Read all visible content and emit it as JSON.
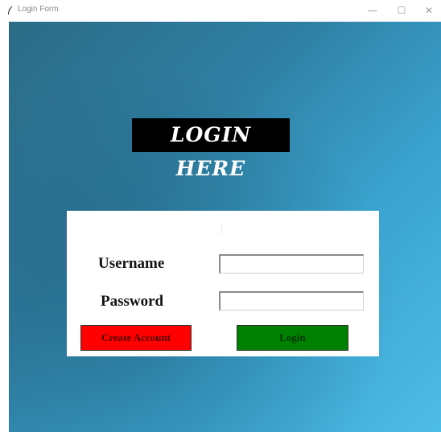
{
  "window": {
    "title": "Login Form",
    "icon": "feather-icon",
    "controls": {
      "minimize": "—",
      "maximize": "☐",
      "close": "✕"
    }
  },
  "heading": "LOGIN HERE",
  "form": {
    "username_label": "Username",
    "password_label": "Password",
    "username_value": "",
    "password_value": "",
    "create_account_label": "Create Account",
    "login_label": "Login"
  },
  "colors": {
    "background_start": "#2b6b86",
    "background_end": "#4dbce6",
    "create_account_button": "#ff0000",
    "login_button": "#008000",
    "heading_background": "#000000"
  }
}
